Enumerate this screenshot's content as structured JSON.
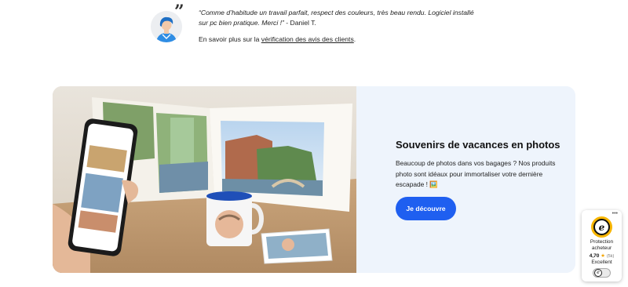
{
  "testimonial": {
    "quote_mark": "”",
    "quote": "“Comme d’habitude un travail parfait, respect des couleurs, très beau rendu. Logiciel installé sur pc bien pratique. Merci !”",
    "author": " - Daniel T.",
    "more_prefix": "En savoir plus sur la ",
    "more_link": "vérification des avis des clients",
    "more_suffix": "."
  },
  "promo": {
    "title": "Souvenirs de vacances en photos",
    "text": "Beaucoup de photos dans vos bagages ? Nos produits photo sont idéaux pour immortaliser votre dernière escapade ! 🖼️",
    "cta_label": "Je découvre",
    "cta_color": "#1f5ff0",
    "background_color": "#eef4fc"
  },
  "trust_badge": {
    "menu": "•••",
    "seal_letter": "e",
    "label": "Protection acheteur",
    "rating": "4,70",
    "star": "★",
    "count": "(5k)",
    "grade": "Excellent",
    "toggle_letter": "e",
    "accent_color": "#f7b500"
  }
}
